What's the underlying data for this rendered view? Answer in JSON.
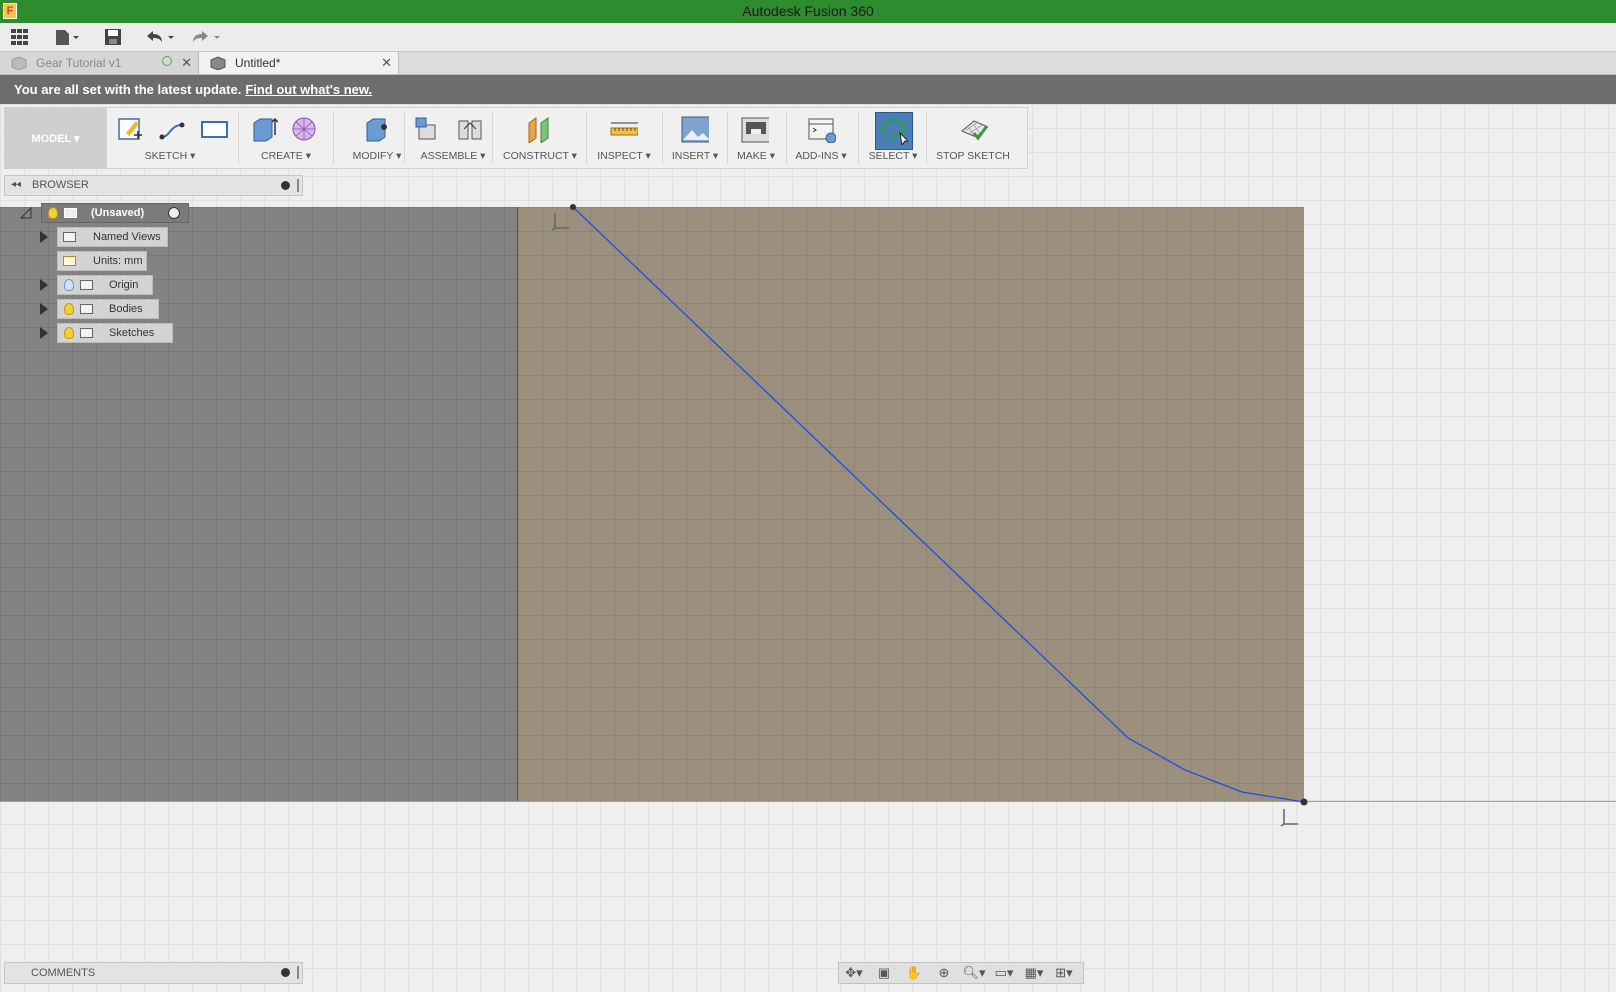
{
  "window": {
    "title": "Autodesk Fusion 360",
    "logo_letter": "F"
  },
  "tabs": [
    {
      "label": "Gear Tutorial v1",
      "close": "✕"
    },
    {
      "label": "Untitled*",
      "close": "✕"
    }
  ],
  "banner": {
    "text": "You are all set with the latest update.",
    "link": "Find out what's new."
  },
  "toolbar": {
    "workspace": "MODEL ▾",
    "groups": {
      "sketch": "SKETCH ▾",
      "create": "CREATE ▾",
      "modify": "MODIFY ▾",
      "assemble": "ASSEMBLE ▾",
      "construct": "CONSTRUCT ▾",
      "inspect": "INSPECT ▾",
      "insert": "INSERT ▾",
      "make": "MAKE ▾",
      "addins": "ADD-INS ▾",
      "select": "SELECT ▾",
      "stop_sketch": "STOP SKETCH"
    }
  },
  "browser": {
    "title": "BROWSER",
    "root": "(Unsaved)",
    "items": [
      "Named Views",
      "Units: mm",
      "Origin",
      "Bodies",
      "Sketches"
    ]
  },
  "comments": {
    "title": "COMMENTS"
  },
  "colors": {
    "titlebar": "#2e8b2e",
    "curve": "#1f4fe0",
    "plane": "#9b8f7e",
    "axis": "#d88a8a"
  }
}
